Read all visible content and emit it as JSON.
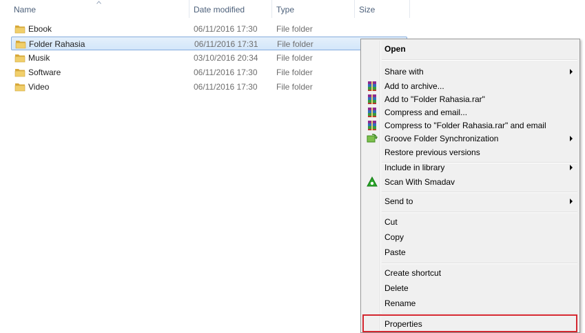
{
  "columns": {
    "name": "Name",
    "date_modified": "Date modified",
    "type": "Type",
    "size": "Size"
  },
  "files": [
    {
      "name": "Ebook",
      "date": "06/11/2016 17:30",
      "type": "File folder",
      "selected": false
    },
    {
      "name": "Folder Rahasia",
      "date": "06/11/2016 17:31",
      "type": "File folder",
      "selected": true
    },
    {
      "name": "Musik",
      "date": "03/10/2016 20:34",
      "type": "File folder",
      "selected": false
    },
    {
      "name": "Software",
      "date": "06/11/2016 17:30",
      "type": "File folder",
      "selected": false
    },
    {
      "name": "Video",
      "date": "06/11/2016 17:30",
      "type": "File folder",
      "selected": false
    }
  ],
  "context_menu": {
    "open": "Open",
    "share_with": "Share with",
    "add_to_archive": "Add to archive...",
    "add_to_rar": "Add to \"Folder Rahasia.rar\"",
    "compress_email": "Compress and email...",
    "compress_rar_email": "Compress to \"Folder Rahasia.rar\" and email",
    "groove_sync": "Groove Folder Synchronization",
    "restore_versions": "Restore previous versions",
    "include_library": "Include in library",
    "scan_smadav": "Scan With Smadav",
    "send_to": "Send to",
    "cut": "Cut",
    "copy": "Copy",
    "paste": "Paste",
    "create_shortcut": "Create shortcut",
    "delete": "Delete",
    "rename": "Rename",
    "properties": "Properties"
  },
  "colors": {
    "selection_border": "#84acdd",
    "highlight_box": "#d3252e",
    "header_text": "#4c607a",
    "folder_yellow": "#e8c25a"
  },
  "icons": {
    "folder": "folder-icon",
    "winrar": "winrar-icon",
    "groove": "groove-icon",
    "smadav": "smadav-icon",
    "sort": "sort-arrow-icon"
  }
}
